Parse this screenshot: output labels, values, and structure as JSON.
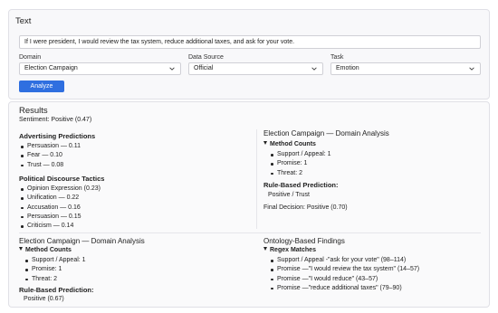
{
  "input_panel": {
    "heading": "Text",
    "text_value": "If I were president, I would review the tax system, reduce additional taxes, and ask for your vote.",
    "fields": [
      {
        "label": "Domain",
        "value": "Election Campaign"
      },
      {
        "label": "Data Source",
        "value": "Official"
      },
      {
        "label": "Task",
        "value": "Emotion"
      }
    ],
    "analyze_label": "Analyze"
  },
  "results": {
    "heading": "Results",
    "sentiment": "Sentiment: Positive (0.47)",
    "advertising": {
      "heading": "Advertising Predictions",
      "items": [
        "Persuasion — 0.11",
        "Fear — 0.10",
        "Trust — 0.08"
      ]
    },
    "political": {
      "heading": "Political Discourse Tactics",
      "items": [
        "Opinion Expression (0.23)",
        "Unification — 0.22",
        "Accusation — 0.16",
        "Persuasion — 0.15",
        "Criticism — 0.14"
      ]
    },
    "domain_right": {
      "title": "Election Campaign — Domain Analysis",
      "method_counts_label": "Method Counts",
      "counts": [
        "Support / Appeal: 1",
        "Promise: 1",
        "Threat: 2"
      ],
      "rule_label": "Rule-Based Prediction:",
      "rule_value": "Positive / Trust",
      "final_decision": "Final Decision: Positive (0.70)"
    },
    "domain_left": {
      "title": "Election Campaign — Domain Analysis",
      "method_counts_label": "Method Counts",
      "counts": [
        "Support / Appeal: 1",
        "Promise: 1",
        "Threat: 2"
      ],
      "rule_label": "Rule-Based Prediction:",
      "rule_value": "Positive (0.67)"
    },
    "ontology": {
      "title": "Ontology-Based Findings",
      "regex_label": "Regex Matches",
      "matches": [
        "Support / Appeal -\"ask for your vote\" (98–114)",
        "Promise —\"I would review the tax system\" (14–57)",
        "Promise —\"I would reduce\" (43–57)",
        "Promise —\"reduce additional taxes\" (79–90)"
      ]
    }
  },
  "colors": {
    "accent": "#2f6fe0",
    "border": "#e0e0e6",
    "panel_bg": "#f8f8fa"
  }
}
